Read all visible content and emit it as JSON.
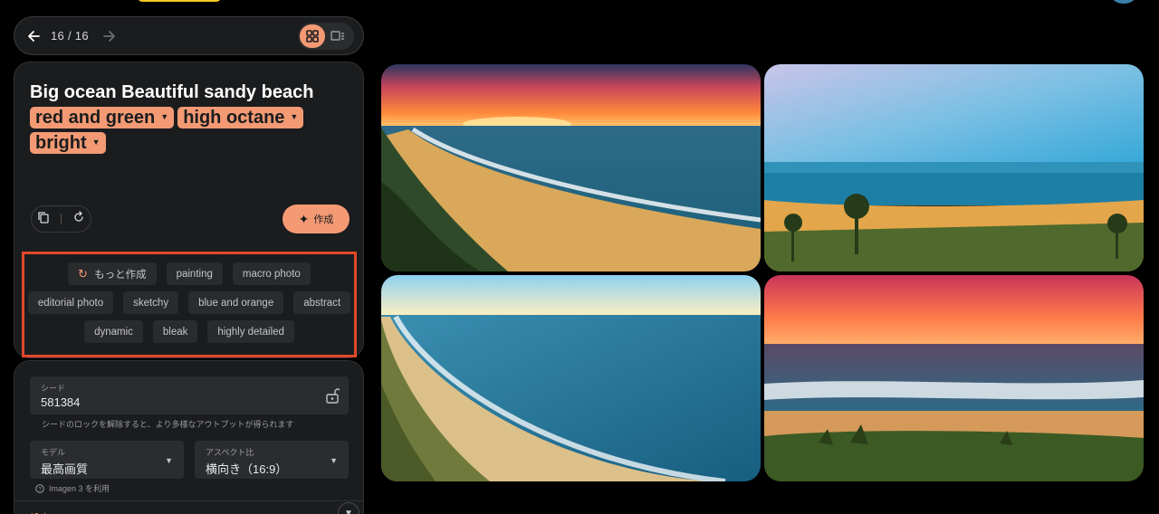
{
  "nav": {
    "counter": "16 / 16"
  },
  "prompt": {
    "base_text": "Big ocean Beautiful sandy beach",
    "chips": [
      "red and green",
      "high octane",
      "bright"
    ]
  },
  "actions": {
    "create_label": "作成"
  },
  "suggestions": {
    "row1": [
      "もっと作成",
      "painting",
      "macro photo"
    ],
    "row2": [
      "editorial photo",
      "sketchy",
      "blue and orange",
      "abstract"
    ],
    "row3": [
      "dynamic",
      "bleak",
      "highly detailed"
    ]
  },
  "settings": {
    "seed_label": "シード",
    "seed_value": "581384",
    "seed_hint": "シードのロックを解除すると、より多様なアウトプットが得られます",
    "model_label": "モデル",
    "model_value": "最高画質",
    "aspect_label": "アスペクト比",
    "aspect_value": "横向き（16:9）",
    "model_hint": "Imagen 3 を利用",
    "section_label": "設定"
  },
  "icons": {
    "back": "arrow-left-icon",
    "forward": "arrow-right-icon",
    "grid": "grid-view-icon",
    "single": "single-view-icon",
    "copy": "copy-icon",
    "reset": "reset-icon",
    "spark": "sparkle-icon",
    "refresh": "refresh-icon",
    "lock": "lock-open-icon",
    "help": "help-icon",
    "chevron": "chevron-down-icon"
  },
  "colors": {
    "accent": "#f39a74",
    "highlight_border": "#e0492b",
    "panel": "#1b1c1e",
    "background": "#000000"
  }
}
